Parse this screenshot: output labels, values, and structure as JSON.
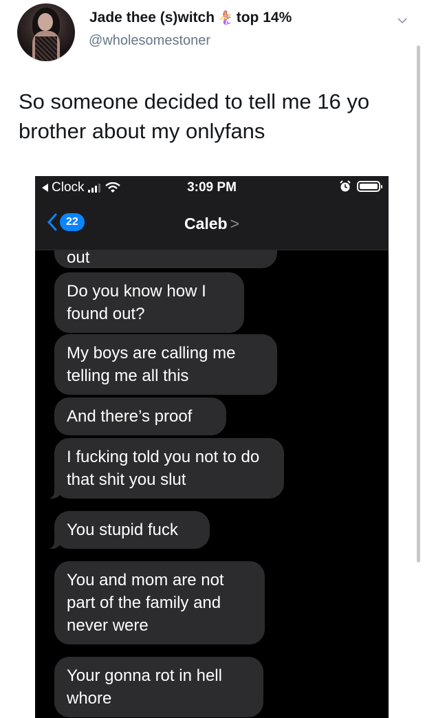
{
  "tweet": {
    "display_name": "Jade thee (s)witch",
    "name_emoji": "🧜‍♀️",
    "badge": "top 14%",
    "handle": "@wholesomestoner",
    "text": "So someone decided to tell me 16 yo brother about my onlyfans"
  },
  "screenshot": {
    "status_bar": {
      "back_app": "Clock",
      "time": "3:09 PM"
    },
    "nav": {
      "back_count": "22",
      "contact_name": "Caleb",
      "contact_arrow": ">"
    },
    "messages": [
      "out",
      "Do you know how I found out?",
      "My boys are calling me telling me all this",
      "And there’s proof",
      "I fucking told you not to do that shit you slut",
      "You stupid fuck",
      "You and mom are not part of the family and never were",
      "Your gonna rot in hell whore"
    ]
  }
}
